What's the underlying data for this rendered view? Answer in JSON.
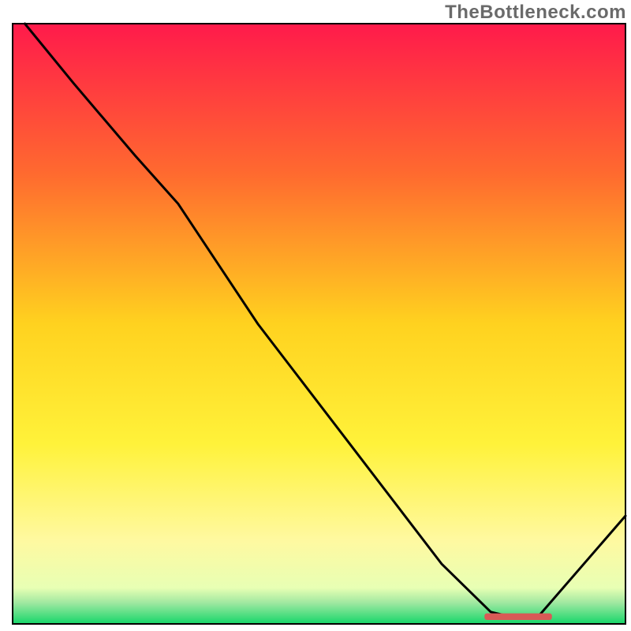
{
  "watermark": "TheBottleneck.com",
  "chart_data": {
    "type": "line",
    "title": "",
    "xlabel": "",
    "ylabel": "",
    "xlim": [
      0,
      100
    ],
    "ylim": [
      0,
      100
    ],
    "background": {
      "type": "vertical-gradient",
      "stops": [
        {
          "offset": 0.0,
          "color": "#ff1a4b"
        },
        {
          "offset": 0.25,
          "color": "#ff6a2f"
        },
        {
          "offset": 0.5,
          "color": "#ffd21f"
        },
        {
          "offset": 0.7,
          "color": "#fff23a"
        },
        {
          "offset": 0.86,
          "color": "#fff9a0"
        },
        {
          "offset": 0.94,
          "color": "#e8ffb4"
        },
        {
          "offset": 0.965,
          "color": "#9fe8a0"
        },
        {
          "offset": 1.0,
          "color": "#16d66a"
        }
      ]
    },
    "series": [
      {
        "name": "bottleneck-curve",
        "color": "#000000",
        "x": [
          2,
          10,
          20,
          27,
          40,
          55,
          70,
          78,
          82,
          86,
          100
        ],
        "y": [
          100,
          90,
          78,
          70,
          50,
          30,
          10,
          2,
          1,
          1.5,
          18
        ]
      }
    ],
    "marker": {
      "name": "optimal-range",
      "color": "#d85a56",
      "x_start": 77,
      "x_end": 88,
      "y": 1.2,
      "height": 1.1
    }
  }
}
